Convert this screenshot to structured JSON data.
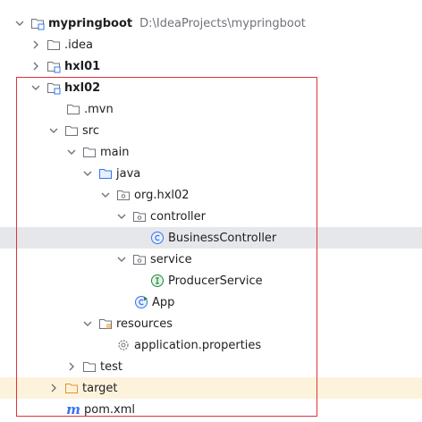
{
  "tree": {
    "root": {
      "name": "mypringboot",
      "path": "D:\\IdeaProjects\\mypringboot"
    },
    "idea": "idea",
    "idea_prefix": ".",
    "hxl01": "hxl01",
    "hxl02": "hxl02",
    "mvn": ".mvn",
    "src": "src",
    "main": "main",
    "java": "java",
    "package": "org.hxl02",
    "controller": "controller",
    "business_controller": "BusinessController",
    "service": "service",
    "producer_service": "ProducerService",
    "app": "App",
    "resources": "resources",
    "properties": "application.properties",
    "test": "test",
    "target": "target",
    "pom": "pom.xml",
    "pom_icon_letter": "m"
  },
  "colors": {
    "highlight_box": "#e0323a",
    "selected_row": "#e6e7ea",
    "target_row": "#fdf3dd",
    "class_icon": "#3574f0",
    "interface_icon": "#208a3c",
    "excluded_folder": "#e88f2a"
  }
}
